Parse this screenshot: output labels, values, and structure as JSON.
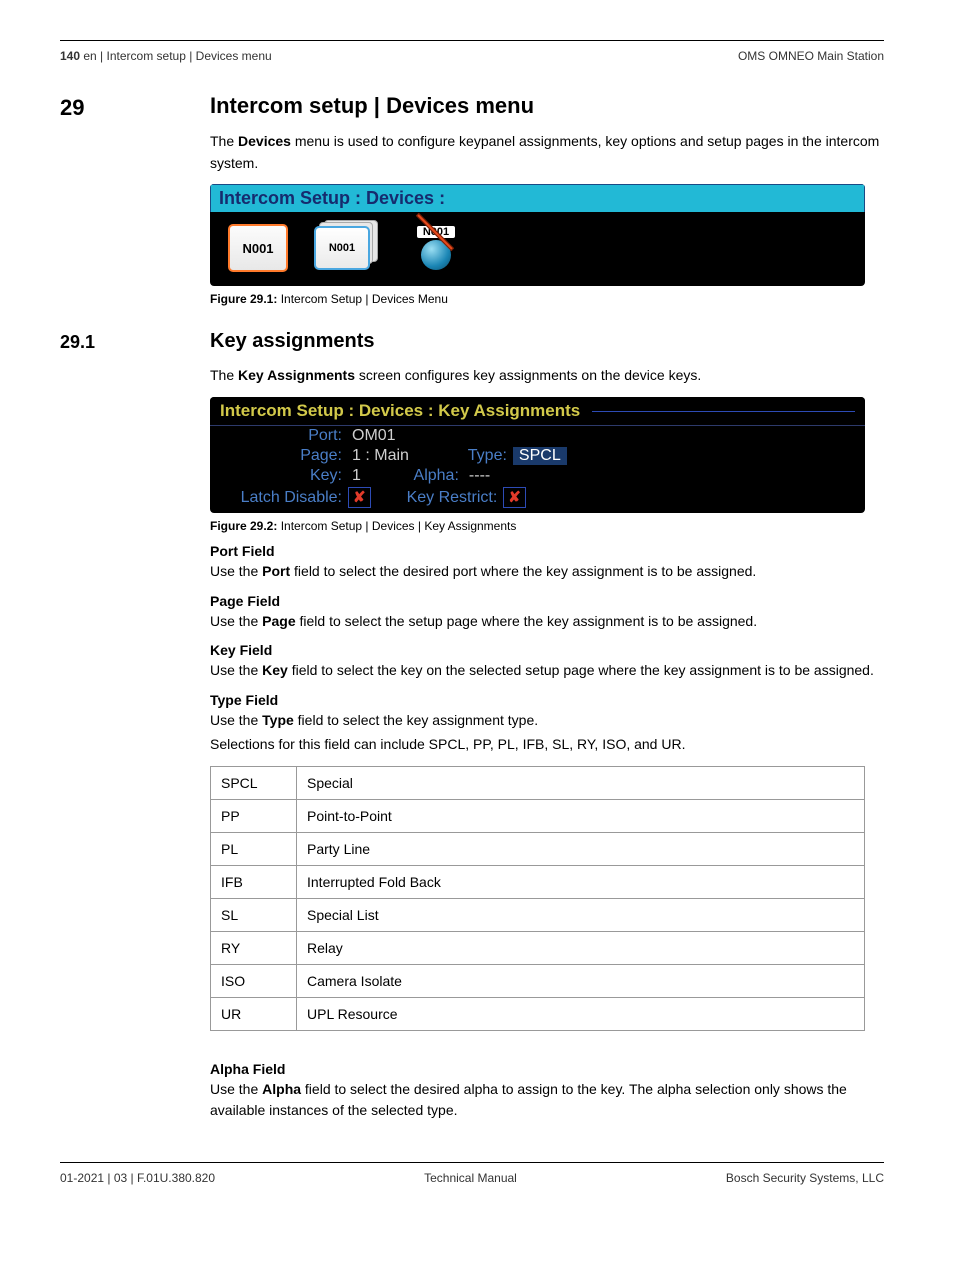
{
  "header": {
    "page_number": "140",
    "breadcrumb": "en | Intercom setup | Devices menu",
    "product": "OMS OMNEO Main Station"
  },
  "section": {
    "number": "29",
    "title": "Intercom setup | Devices menu",
    "intro_pre": "The ",
    "intro_bold": "Devices",
    "intro_post": " menu is used to configure keypanel assignments, key options and setup pages in the intercom system."
  },
  "fig291": {
    "title": "Intercom Setup : Devices :",
    "tile1": "N001",
    "tile2": "N001",
    "tile3": "N001",
    "caption_bold": "Figure 29.1:",
    "caption_rest": " Intercom Setup | Devices Menu"
  },
  "subsection": {
    "number": "29.1",
    "title": "Key assignments",
    "intro_pre": "The ",
    "intro_bold": "Key Assignments",
    "intro_post": " screen configures key assignments on the device keys."
  },
  "fig292": {
    "title": "Intercom Setup : Devices : Key Assignments",
    "port_label": "Port:",
    "port_value": "OM01",
    "page_label": "Page:",
    "page_value": "1 : Main",
    "type_label": "Type:",
    "type_value": "SPCL",
    "key_label": "Key:",
    "key_value": "1",
    "alpha_label": "Alpha:",
    "alpha_value": "----",
    "latch_label": "Latch Disable:",
    "latch_value": "✘",
    "restrict_label": "Key Restrict:",
    "restrict_value": "✘",
    "caption_bold": "Figure 29.2:",
    "caption_rest": " Intercom Setup | Devices | Key Assignments"
  },
  "fields": {
    "port": {
      "title": "Port Field",
      "pre": "Use the ",
      "bold": "Port",
      "post": " field to select the desired port where the key assignment is to be assigned."
    },
    "page": {
      "title": "Page Field",
      "pre": "Use the ",
      "bold": "Page",
      "post": " field to select the setup page where the key assignment is to be assigned."
    },
    "key": {
      "title": "Key Field",
      "pre": "Use the ",
      "bold": "Key",
      "post": " field to select the key on the selected setup page where the key assignment is to be assigned."
    },
    "type": {
      "title": "Type Field",
      "pre": "Use the ",
      "bold": "Type",
      "post": " field to select the key assignment type.",
      "line2": "Selections for this field can include SPCL, PP, PL, IFB, SL, RY, ISO, and UR."
    },
    "alpha": {
      "title": "Alpha Field",
      "pre": "Use the ",
      "bold": "Alpha",
      "post": " field to select the desired alpha to assign to the key. The alpha selection only shows the available instances of the selected type."
    }
  },
  "type_table": [
    {
      "code": "SPCL",
      "desc": "Special"
    },
    {
      "code": "PP",
      "desc": "Point-to-Point"
    },
    {
      "code": "PL",
      "desc": "Party Line"
    },
    {
      "code": "IFB",
      "desc": "Interrupted Fold Back"
    },
    {
      "code": "SL",
      "desc": "Special List"
    },
    {
      "code": "RY",
      "desc": "Relay"
    },
    {
      "code": "ISO",
      "desc": "Camera Isolate"
    },
    {
      "code": "UR",
      "desc": "UPL Resource"
    }
  ],
  "footer": {
    "left": "01-2021 | 03 | F.01U.380.820",
    "center": "Technical Manual",
    "right": "Bosch Security Systems, LLC"
  }
}
